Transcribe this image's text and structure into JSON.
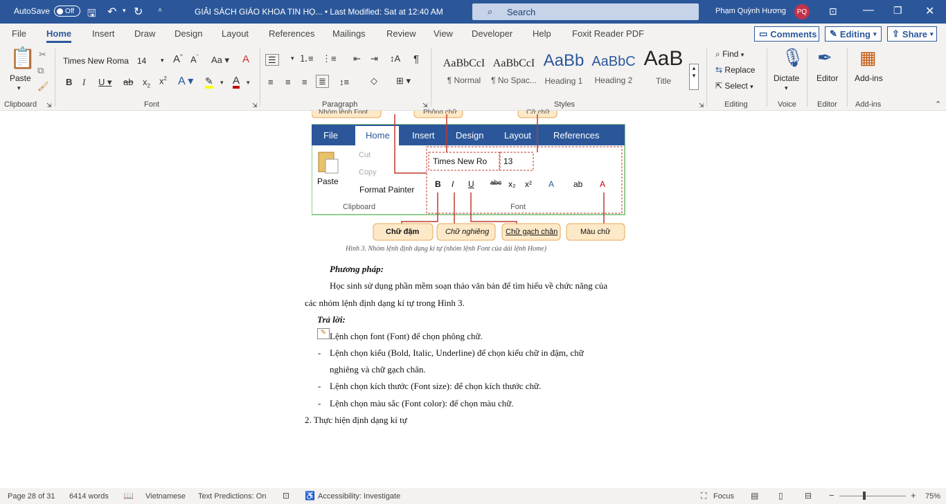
{
  "titlebar": {
    "autosave_label": "AutoSave",
    "autosave_state": "Off",
    "doc_title": "GIẢI SÁCH GIÁO KHOA TIN HỌ... • Last Modified: Sat at 12:40 AM",
    "search_placeholder": "Search",
    "user_name": "Phạm Quỳnh Hương",
    "user_initials": "PQ"
  },
  "menu": {
    "tabs": [
      "File",
      "Home",
      "Insert",
      "Draw",
      "Design",
      "Layout",
      "References",
      "Mailings",
      "Review",
      "View",
      "Developer",
      "Help",
      "Foxit Reader PDF"
    ],
    "active": "Home",
    "comments_label": "Comments",
    "editing_label": "Editing",
    "share_label": "Share"
  },
  "ribbon": {
    "clipboard": {
      "paste": "Paste",
      "label": "Clipboard"
    },
    "font": {
      "name": "Times New Roma",
      "size": "14",
      "label": "Font"
    },
    "paragraph": {
      "label": "Paragraph"
    },
    "styles": {
      "label": "Styles",
      "items": [
        {
          "preview": "AaBbCcI",
          "name": "¶ Normal"
        },
        {
          "preview": "AaBbCcI",
          "name": "¶ No Spac..."
        },
        {
          "preview": "AaBb",
          "name": "Heading 1"
        },
        {
          "preview": "AaBbC",
          "name": "Heading 2"
        },
        {
          "preview": "AaB",
          "name": "Title"
        }
      ]
    },
    "editing": {
      "find": "Find",
      "replace": "Replace",
      "select": "Select",
      "label": "Editing"
    },
    "voice": {
      "dictate": "Dictate",
      "label": "Voice"
    },
    "editor": {
      "btn": "Editor",
      "label": "Editor"
    },
    "addins": {
      "btn": "Add-ins",
      "label": "Add-ins"
    }
  },
  "figure": {
    "top_callouts": [
      "Nhóm lệnh Font",
      "Phông chữ",
      "Cỡ chữ"
    ],
    "tabs": [
      "File",
      "Home",
      "Insert",
      "Design",
      "Layout",
      "References"
    ],
    "clipboard_items": [
      "Cut",
      "Copy",
      "Format Painter"
    ],
    "paste": "Paste",
    "clipboard_label": "Clipboard",
    "font_box": "Times New Ro",
    "size_box": "13",
    "font_label": "Font",
    "bottom_callouts": [
      "Chữ đậm",
      "Chữ nghiêng",
      "Chữ gạch chân",
      "Màu chữ"
    ],
    "caption": "Hình 3. Nhóm lệnh định dạng kí tự (nhóm lệnh Font của dải lệnh Home)"
  },
  "document": {
    "heading1": "Phương pháp:",
    "para1a": "Học sinh sử dụng phần mềm soạn thảo văn bản để tìm hiểu về chức năng của",
    "para1b": "các nhóm lệnh định dạng kí tự trong Hình 3.",
    "heading2": "Trả lời:",
    "items": [
      "Lệnh chọn font (Font) để chọn phông chữ.",
      "Lệnh chọn kiểu (Bold, Italic, Underline) để chọn kiểu chữ in đậm, chữ",
      "nghiêng và chữ gạch chân.",
      "Lệnh chọn kích thước (Font size): để chọn kích thước chữ.",
      "Lệnh chọn màu sắc (Font color): để chọn màu chữ."
    ],
    "section2": "2. Thực hiện định dạng kí tự"
  },
  "status": {
    "page": "Page 28 of 31",
    "words": "6414 words",
    "language": "Vietnamese",
    "predictions": "Text Predictions: On",
    "accessibility": "Accessibility: Investigate",
    "focus": "Focus",
    "zoom": "75%"
  }
}
